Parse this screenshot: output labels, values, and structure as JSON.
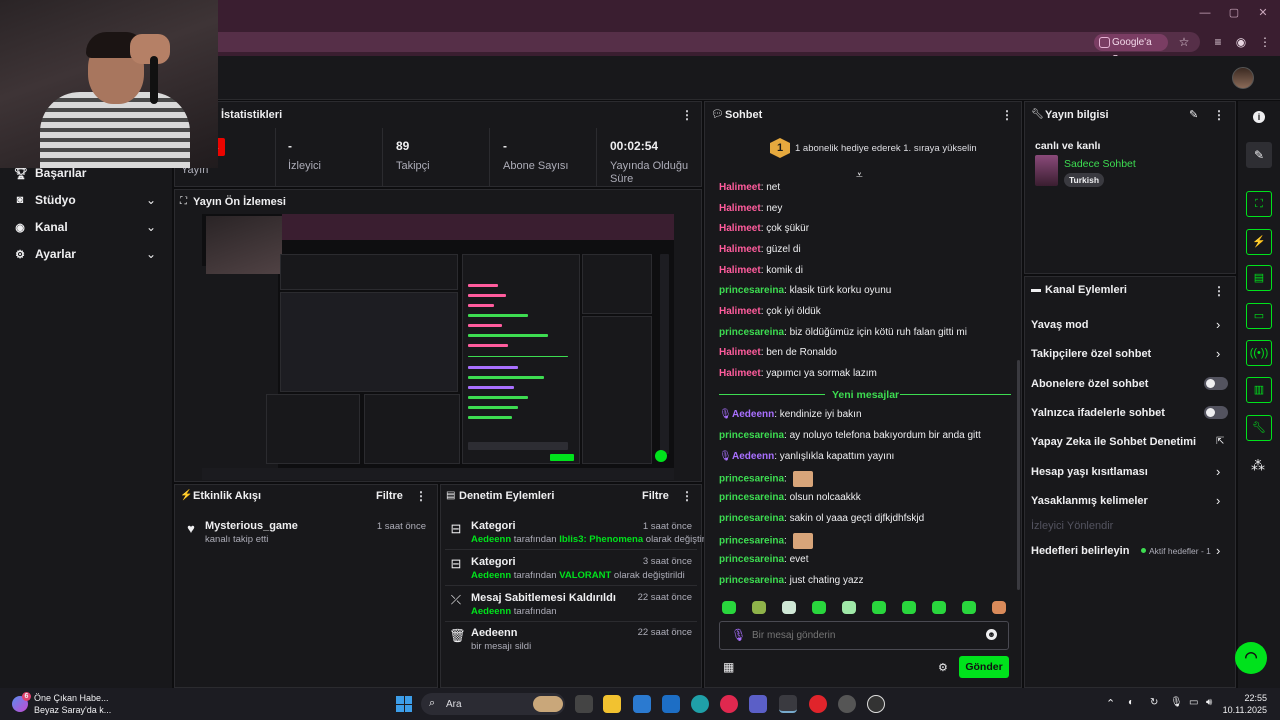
{
  "browser": {
    "ask_google": "Google'a Sor"
  },
  "sidebar": {
    "items": [
      {
        "label": "Başarılar",
        "icon": "trophy-icon"
      },
      {
        "label": "Stüdyo",
        "icon": "studio-icon"
      },
      {
        "label": "Kanal",
        "icon": "channel-icon"
      },
      {
        "label": "Ayarlar",
        "icon": "settings-icon"
      }
    ]
  },
  "stats": {
    "title": "İstatistikleri",
    "live_badge": "A",
    "cells": [
      {
        "value": "",
        "label": "Yayın"
      },
      {
        "value": "-",
        "label": "İzleyici"
      },
      {
        "value": "89",
        "label": "Takipçi"
      },
      {
        "value": "-",
        "label": "Abone Sayısı"
      },
      {
        "value": "00:02:54",
        "label": "Yayında Olduğu Süre"
      }
    ]
  },
  "preview": {
    "title": "Yayın Ön İzlemesi"
  },
  "activity": {
    "title": "Etkinlik Akışı",
    "filter": "Filtre",
    "items": [
      {
        "title": "Mysterious_game",
        "sub": "kanalı takip etti",
        "time": "1 saat önce"
      }
    ]
  },
  "moderation": {
    "title": "Denetim Eylemleri",
    "filter": "Filtre",
    "items": [
      {
        "title": "Kategori",
        "actor": "Aedeenn",
        "mid": "tarafından",
        "value": "Iblis3: Phenomena",
        "end": "olarak değiştirildi",
        "time": "1 saat önce"
      },
      {
        "title": "Kategori",
        "actor": "Aedeenn",
        "mid": "tarafından",
        "value": "VALORANT",
        "end": "olarak değiştirildi",
        "time": "3 saat önce"
      },
      {
        "title": "Mesaj Sabitlemesi Kaldırıldı",
        "actor": "Aedeenn",
        "mid": "tarafından",
        "value": "",
        "end": "",
        "time": "22 saat önce"
      },
      {
        "title": "Aedeenn",
        "actor": "",
        "mid": "bir mesajı sildi",
        "value": "",
        "end": "",
        "time": "22 saat önce"
      }
    ]
  },
  "chat": {
    "title": "Sohbet",
    "gift_rank": "1",
    "gift_text": "1 abonelik hediye ederek 1. sıraya yükselin",
    "new_messages": "Yeni mesajlar",
    "placeholder": "Bir mesaj gönderin",
    "send": "Gönder",
    "colors": {
      "halimeet": "#ff5c9d",
      "princesareina": "#3ddc51",
      "aedeenn": "#a970ff"
    },
    "messages": [
      {
        "user": "Halimeet",
        "text": "net",
        "badge": false,
        "emote": false
      },
      {
        "user": "Halimeet",
        "text": "ney",
        "badge": false,
        "emote": false
      },
      {
        "user": "Halimeet",
        "text": "çok şükür",
        "badge": false,
        "emote": false
      },
      {
        "user": "Halimeet",
        "text": "güzel di",
        "badge": false,
        "emote": false
      },
      {
        "user": "Halimeet",
        "text": "komik di",
        "badge": false,
        "emote": false
      },
      {
        "user": "princesareina",
        "text": "klasik türk korku oyunu",
        "badge": false,
        "emote": false
      },
      {
        "user": "Halimeet",
        "text": "çok iyi öldük",
        "badge": false,
        "emote": false
      },
      {
        "user": "princesareina",
        "text": "biz öldüğümüz için kötü ruh falan gitti mi",
        "badge": false,
        "emote": false
      },
      {
        "user": "Halimeet",
        "text": "ben de Ronaldo",
        "badge": false,
        "emote": false
      },
      {
        "user": "Halimeet",
        "text": "yapımcı ya sormak lazım",
        "badge": false,
        "emote": false
      },
      {
        "user": "Aedeenn",
        "text": "kendinize iyi bakın",
        "badge": true,
        "emote": false
      },
      {
        "user": "princesareina",
        "text": "ay noluyo telefona bakıyordum bir anda gitt",
        "badge": false,
        "emote": false
      },
      {
        "user": "Aedeenn",
        "text": "yanlışlıkla kapattım yayını",
        "badge": true,
        "emote": false
      },
      {
        "user": "princesareina",
        "text": "",
        "badge": false,
        "emote": true
      },
      {
        "user": "princesareina",
        "text": "olsun nolcaakkk",
        "badge": false,
        "emote": false
      },
      {
        "user": "princesareina",
        "text": "sakin ol yaaa geçti djfkjdhfskjd",
        "badge": false,
        "emote": false
      },
      {
        "user": "princesareina",
        "text": "",
        "badge": false,
        "emote": true
      },
      {
        "user": "princesareina",
        "text": "evet",
        "badge": false,
        "emote": false
      },
      {
        "user": "princesareina",
        "text": "just chating yazz",
        "badge": false,
        "emote": false
      }
    ]
  },
  "stream_info": {
    "title": "Yayın bilgisi",
    "stream_title": "canlı ve kanlı",
    "category": "Sadece Sohbet",
    "tag": "Turkish"
  },
  "channel_actions": {
    "title": "Kanal Eylemleri",
    "items": [
      {
        "label": "Yavaş mod",
        "control": "chevron"
      },
      {
        "label": "Takipçilere özel sohbet",
        "control": "chevron"
      },
      {
        "label": "Abonelere özel sohbet",
        "control": "toggle"
      },
      {
        "label": "Yalnızca ifadelerle sohbet",
        "control": "toggle"
      },
      {
        "label": "Yapay Zeka ile Sohbet Denetimi",
        "control": "external"
      },
      {
        "label": "Hesap yaşı kısıtlaması",
        "control": "chevron"
      },
      {
        "label": "Yasaklanmış kelimeler",
        "control": "chevron"
      },
      {
        "label": "İzleyici Yönlendir",
        "control": "none"
      },
      {
        "label": "Hedefleri belirleyin",
        "control": "chevron"
      }
    ],
    "goals_status": "Aktif hedefler - 1"
  },
  "taskbar": {
    "news_title": "Öne Çıkan Habe...",
    "news_sub": "Beyaz Saray'da k...",
    "news_badge": "6",
    "search": "Ara",
    "time": "22:55",
    "date": "10.11.2025"
  }
}
